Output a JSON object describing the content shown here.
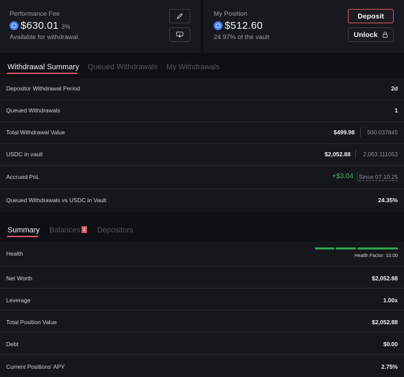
{
  "performance_fee": {
    "label": "Performance Fee",
    "amount": "$630.01",
    "percent": "3%",
    "sub": "Available for withdrawal."
  },
  "my_position": {
    "label": "My Position",
    "amount": "$512.60",
    "sub": "24.97% of the vault",
    "deposit_label": "Deposit",
    "unlock_label": "Unlock"
  },
  "withdrawal_tabs": [
    "Withdrawal Summary",
    "Queued Withdrawals",
    "My Withdrawals"
  ],
  "withdrawal_rows": [
    {
      "label": "Depositor Withdrawal Period",
      "value": "2d"
    },
    {
      "label": "Queued Withdrawals",
      "value": "1"
    },
    {
      "label": "Total Withdrawal Value",
      "value": "$499.98",
      "secondary": "500.037845"
    },
    {
      "label": "USDC in vault",
      "value": "$2,052.88",
      "secondary": "2,053.111053"
    },
    {
      "label": "Accrued PnL",
      "value": "+$3.04",
      "secondary": "Since 07.10.25"
    },
    {
      "label": "Queued Withdrawals vs USDC in Vault",
      "value": "24.35%"
    }
  ],
  "summary_tabs": [
    "Summary",
    "Balances",
    "Depositors"
  ],
  "balances_badge": "1",
  "summary_rows": [
    {
      "label": "Health",
      "value": "Health Factor: 10.00"
    },
    {
      "label": "Net Worth",
      "value": "$2,052.88"
    },
    {
      "label": "Leverage",
      "value": "1.00x"
    },
    {
      "label": "Total Position Value",
      "value": "$2,052.88"
    },
    {
      "label": "Debt",
      "value": "$0.00"
    },
    {
      "label": "Current Positions' APY",
      "value": "2.75%"
    }
  ],
  "colors": {
    "accent": "#d8596a",
    "positive": "#3fb35f",
    "health": "#2ea44f"
  }
}
